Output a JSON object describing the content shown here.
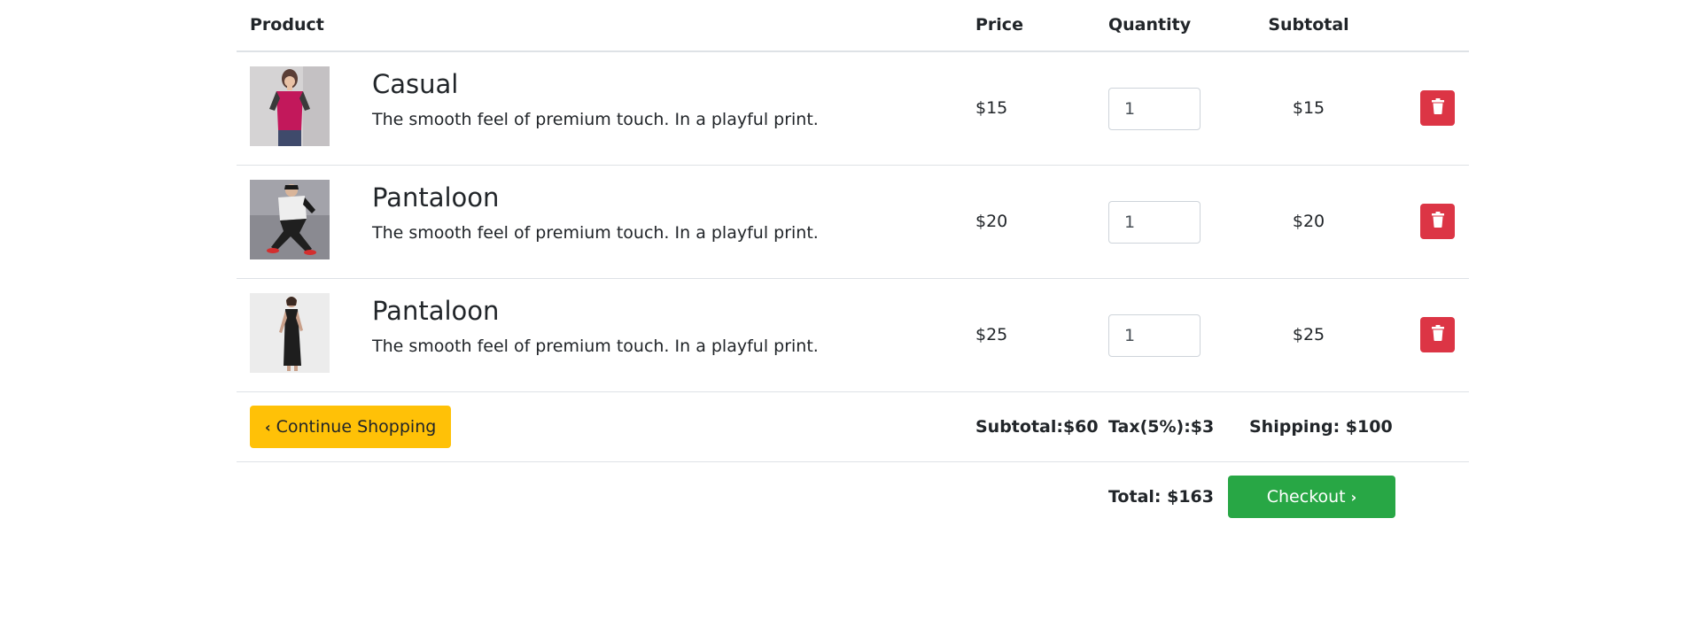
{
  "table_header": {
    "product": "Product",
    "price": "Price",
    "quantity": "Quantity",
    "subtotal": "Subtotal"
  },
  "items": [
    {
      "name": "Casual",
      "description": "The smooth feel of premium touch. In a playful print.",
      "price": "$15",
      "quantity": "1",
      "subtotal": "$15"
    },
    {
      "name": "Pantaloon",
      "description": "The smooth feel of premium touch. In a playful print.",
      "price": "$20",
      "quantity": "1",
      "subtotal": "$20"
    },
    {
      "name": "Pantaloon",
      "description": "The smooth feel of premium touch. In a playful print.",
      "price": "$25",
      "quantity": "1",
      "subtotal": "$25"
    }
  ],
  "summary": {
    "continue_label": "Continue Shopping",
    "subtotal": "Subtotal:$60",
    "tax": "Tax(5%):$3",
    "shipping": "Shipping: $100",
    "total": "Total: $163",
    "checkout_label": "Checkout"
  },
  "icons": {
    "delete": "trash-icon",
    "continue_chevron": "chevron-left-icon",
    "checkout_chevron": "chevron-right-icon"
  },
  "colors": {
    "delete_button": "#dc3545",
    "continue_button": "#ffc107",
    "checkout_button": "#28a745"
  }
}
